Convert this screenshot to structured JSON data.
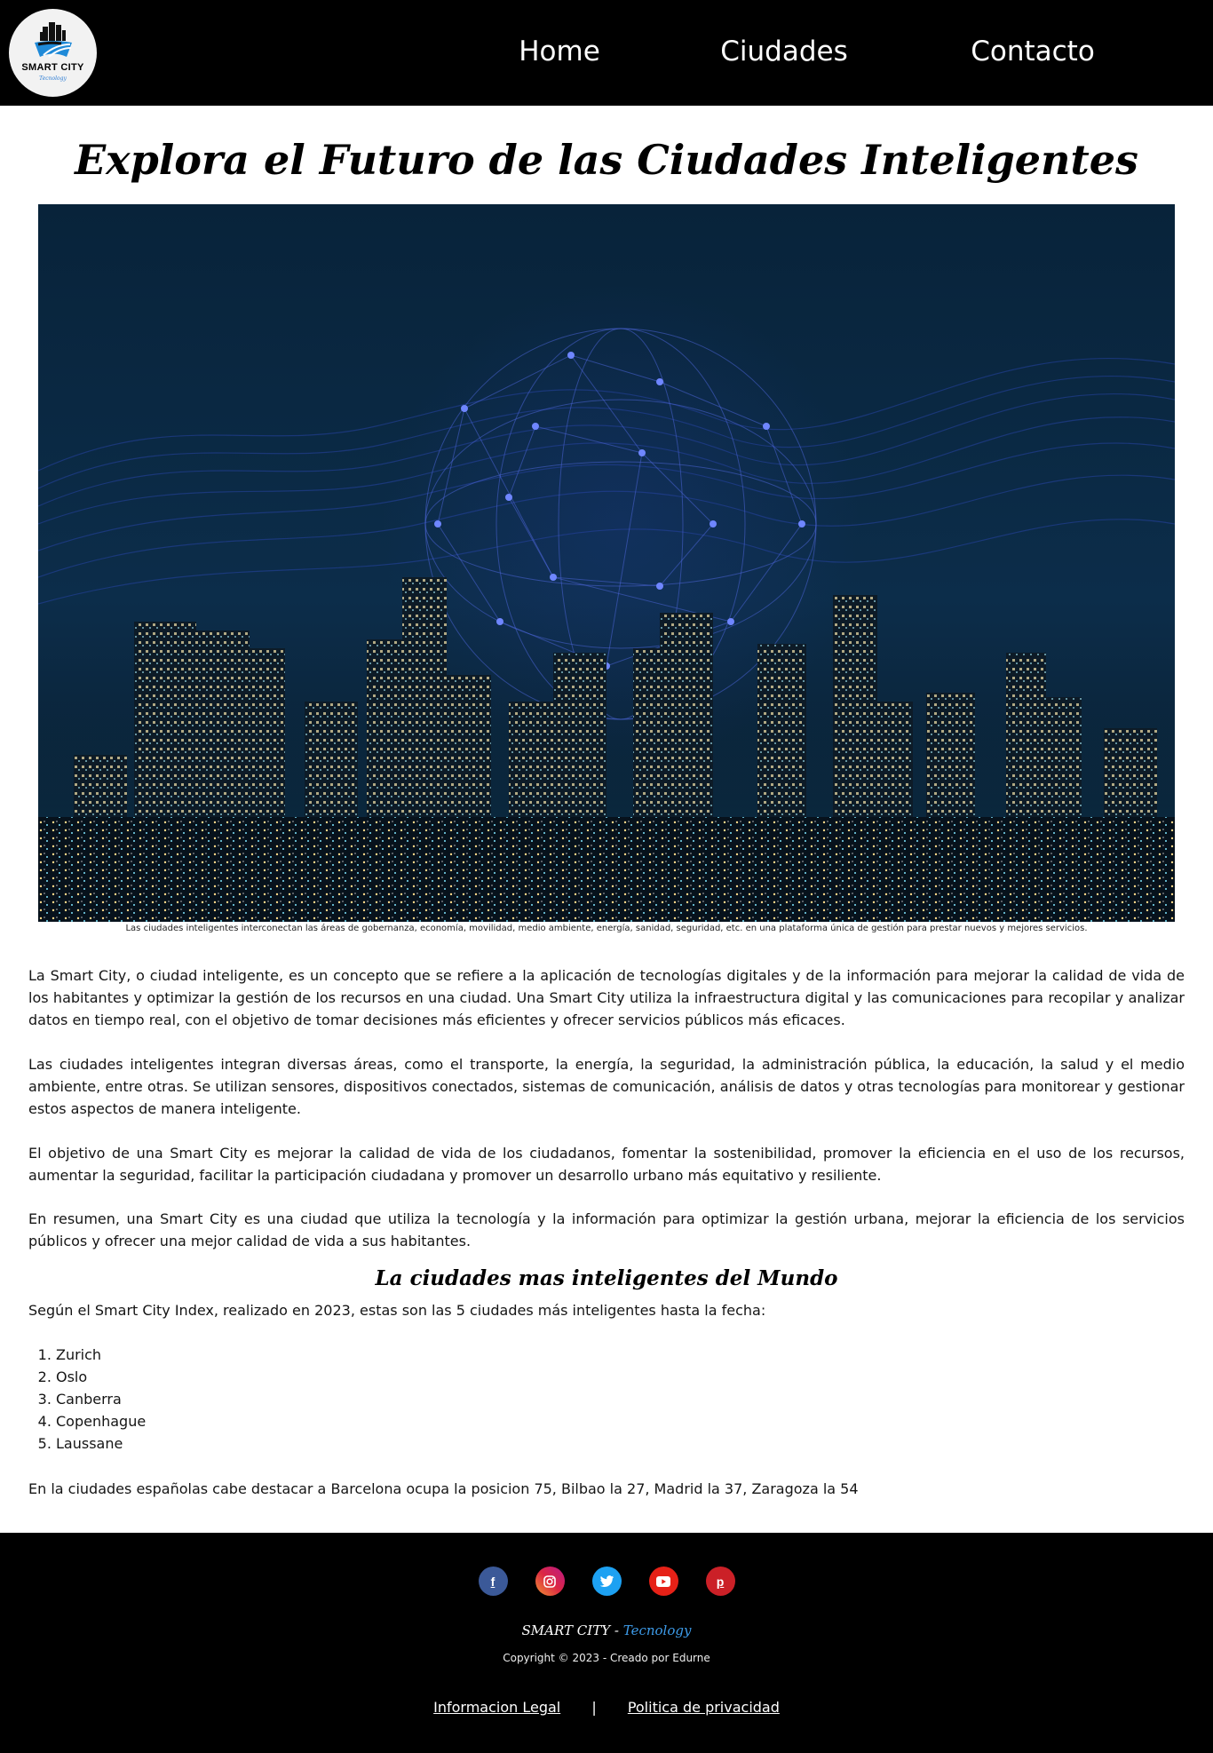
{
  "header": {
    "logo": {
      "title": "SMART CITY",
      "subtitle": "Tecnology"
    },
    "nav": [
      {
        "label": "Home"
      },
      {
        "label": "Ciudades"
      },
      {
        "label": "Contacto"
      }
    ]
  },
  "main": {
    "title": "Explora el Futuro de las Ciudades Inteligentes",
    "hero_caption": "Las ciudades inteligentes interconectan las áreas de gobernanza, economía, movilidad, medio ambiente, energía, sanidad, seguridad, etc. en una plataforma única de gestión para prestar nuevos y mejores servicios.",
    "paragraphs": [
      "La Smart City, o ciudad inteligente, es un concepto que se refiere a la aplicación de tecnologías digitales y de la información para mejorar la calidad de vida de los habitantes y optimizar la gestión de los recursos en una ciudad. Una Smart City utiliza la infraestructura digital y las comunicaciones para recopilar y analizar datos en tiempo real, con el objetivo de tomar decisiones más eficientes y ofrecer servicios públicos más eficaces.",
      "Las ciudades inteligentes integran diversas áreas, como el transporte, la energía, la seguridad, la administración pública, la educación, la salud y el medio ambiente, entre otras. Se utilizan sensores, dispositivos conectados, sistemas de comunicación, análisis de datos y otras tecnologías para monitorear y gestionar estos aspectos de manera inteligente.",
      "El objetivo de una Smart City es mejorar la calidad de vida de los ciudadanos, fomentar la sostenibilidad, promover la eficiencia en el uso de los recursos, aumentar la seguridad, facilitar la participación ciudadana y promover un desarrollo urbano más equitativo y resiliente.",
      "En resumen, una Smart City es una ciudad que utiliza la tecnología y la información para optimizar la gestión urbana, mejorar la eficiencia de los servicios públicos y ofrecer una mejor calidad de vida a sus habitantes."
    ],
    "ranking": {
      "title": "La ciudades mas inteligentes del Mundo",
      "intro": "Según el Smart City Index, realizado en 2023, estas son las 5 ciudades más inteligentes hasta la fecha:",
      "cities": [
        "Zurich",
        "Oslo",
        "Canberra",
        "Copenhague",
        "Laussane"
      ],
      "closing": "En la ciudades españolas cabe destacar a Barcelona ocupa la posicion 75, Bilbao la 27, Madrid la 37, Zaragoza la 54"
    }
  },
  "footer": {
    "social_icons": [
      "facebook-icon",
      "instagram-icon",
      "twitter-icon",
      "youtube-icon",
      "pinterest-icon"
    ],
    "brand": "SMART CITY",
    "brand_separator": " - ",
    "brand_accent": "Tecnology",
    "copyright": "Copyright © 2023 - Creado por Edurne",
    "links": [
      {
        "label": "Informacion Legal"
      },
      {
        "label": "Politica de privacidad"
      }
    ],
    "link_separator": "|"
  },
  "colors": {
    "header_bg": "#000000",
    "footer_bg": "#000000",
    "brand_accent": "#3d9be9"
  }
}
